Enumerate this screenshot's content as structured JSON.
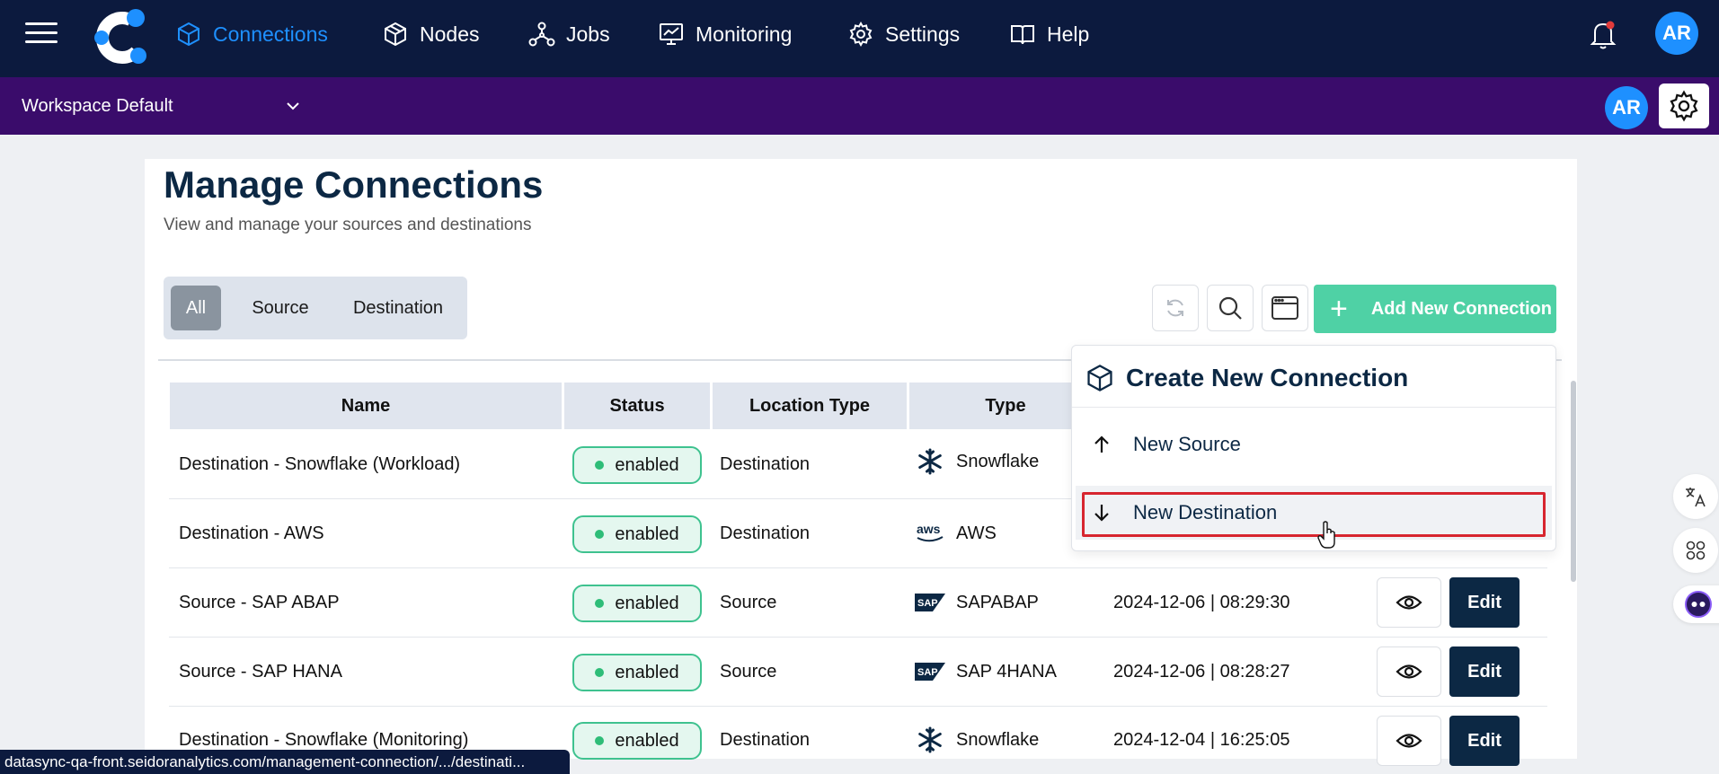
{
  "nav": {
    "items": [
      {
        "label": "Connections",
        "icon": "cube-icon",
        "active": true
      },
      {
        "label": "Nodes",
        "icon": "boxes-icon"
      },
      {
        "label": "Jobs",
        "icon": "network-icon"
      },
      {
        "label": "Monitoring",
        "icon": "chart-monitor-icon"
      },
      {
        "label": "Settings",
        "icon": "gear-icon"
      },
      {
        "label": "Help",
        "icon": "book-icon"
      }
    ],
    "avatar": "AR",
    "active_color": "#1e90ff"
  },
  "workspace": {
    "name": "Workspace Default",
    "avatar": "AR"
  },
  "page": {
    "title": "Manage Connections",
    "subtitle": "View and manage your sources and destinations"
  },
  "filters": [
    "All",
    "Source",
    "Destination"
  ],
  "actions": {
    "add_label": "Add New Connection",
    "add_icon": "+"
  },
  "table": {
    "headers": [
      "Name",
      "Status",
      "Location Type",
      "Type"
    ],
    "rows": [
      {
        "name": "Destination - Snowflake (Workload)",
        "status": "enabled",
        "location": "Destination",
        "type": "Snowflake",
        "type_icon": "snowflake-icon",
        "date": ""
      },
      {
        "name": "Destination - AWS",
        "status": "enabled",
        "location": "Destination",
        "type": "AWS",
        "type_icon": "aws-icon",
        "date": ""
      },
      {
        "name": "Source - SAP ABAP",
        "status": "enabled",
        "location": "Source",
        "type": "SAPABAP",
        "type_icon": "sap-icon",
        "date": "2024-12-06 | 08:29:30"
      },
      {
        "name": "Source - SAP HANA",
        "status": "enabled",
        "location": "Source",
        "type": "SAP 4HANA",
        "type_icon": "sap-icon",
        "date": "2024-12-06 | 08:28:27"
      },
      {
        "name": "Destination - Snowflake (Monitoring)",
        "status": "enabled",
        "location": "Destination",
        "type": "Snowflake",
        "type_icon": "snowflake-icon",
        "date": "2024-12-04 | 16:25:05"
      }
    ],
    "edit_label": "Edit"
  },
  "dropdown": {
    "title": "Create New Connection",
    "items": [
      "New Source",
      "New Destination"
    ]
  },
  "status_url": "datasync-qa-front.seidoranalytics.com/management-connection/.../destinati..."
}
